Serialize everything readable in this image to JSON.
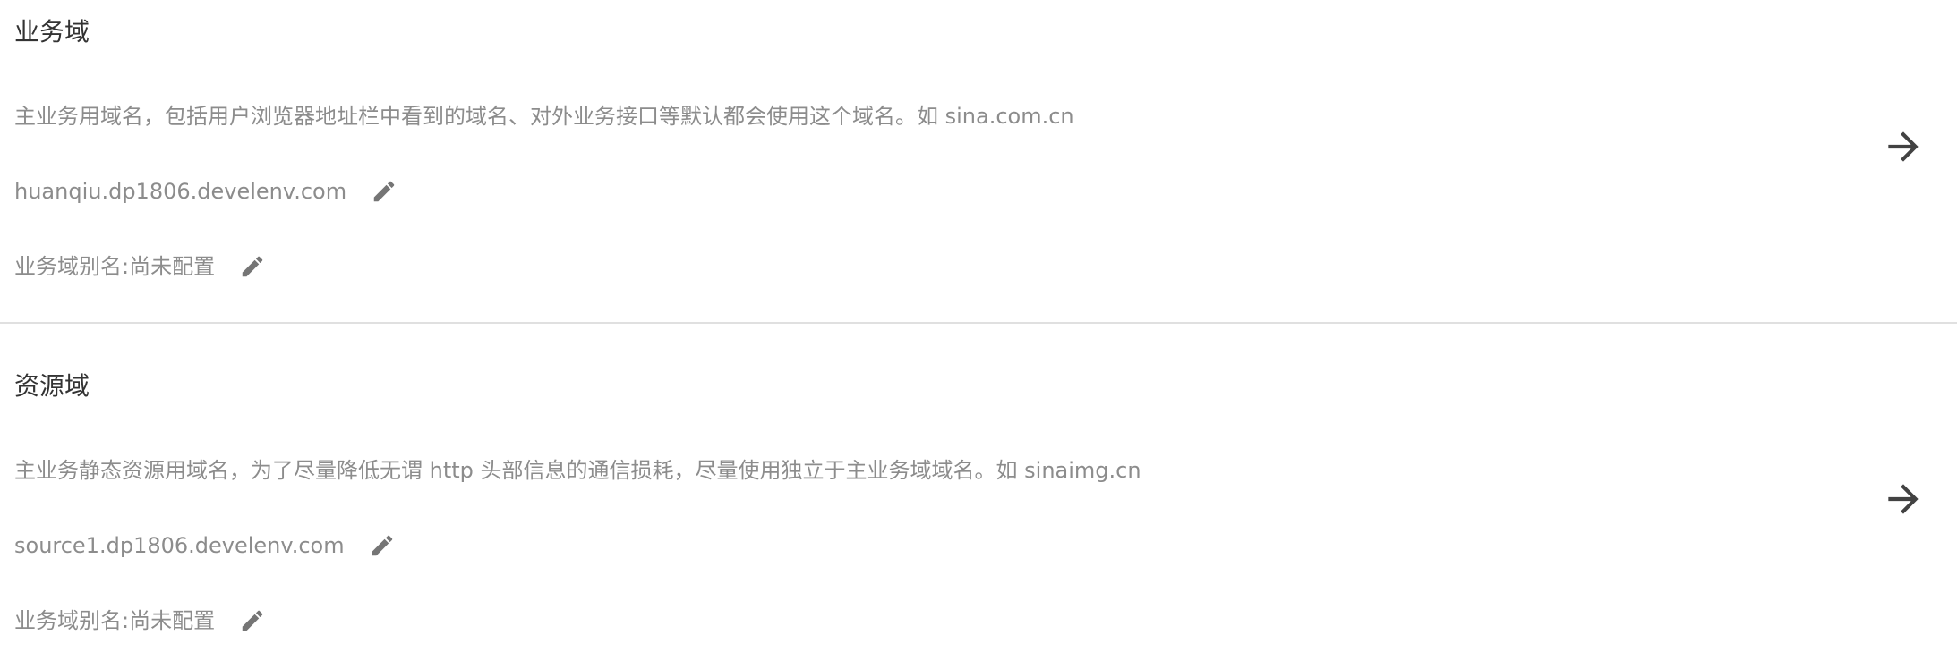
{
  "sections": [
    {
      "title": "业务域",
      "description": "主业务用域名，包括用户浏览器地址栏中看到的域名、对外业务接口等默认都会使用这个域名。如 sina.com.cn",
      "domain": "huanqiu.dp1806.develenv.com",
      "alias": "业务域别名:尚未配置"
    },
    {
      "title": "资源域",
      "description": "主业务静态资源用域名，为了尽量降低无谓 http 头部信息的通信损耗，尽量使用独立于主业务域域名。如 sinaimg.cn",
      "domain": "source1.dp1806.develenv.com",
      "alias": "业务域别名:尚未配置"
    }
  ],
  "icons": {
    "edit": "pencil-icon",
    "navigate": "arrow-right-icon"
  },
  "colors": {
    "title": "#333333",
    "text": "#8c8c8c",
    "icon": "#757575",
    "divider": "#e0e0e0"
  }
}
